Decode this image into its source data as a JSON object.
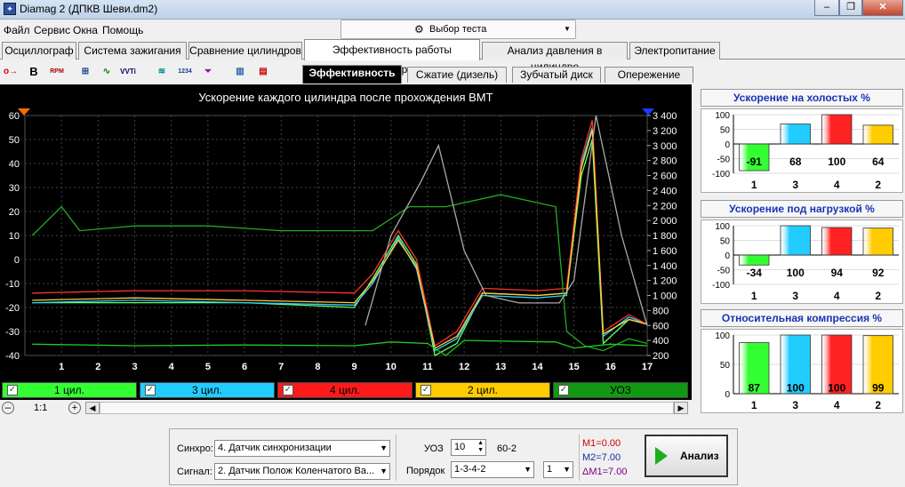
{
  "window": {
    "title": "Diamag 2 (ДПКВ Шеви.dm2)",
    "icon": "app-icon"
  },
  "menu": [
    "Файл",
    "Сервис",
    "Окна",
    "Помощь"
  ],
  "test_select": {
    "label": "Выбор теста",
    "icon": "gear-icon"
  },
  "tabs": [
    "Осциллограф",
    "Система зажигания",
    "Сравнение цилиндров",
    "Эффективность работы цилиндров",
    "Анализ давления в цилиндре",
    "Электропитание"
  ],
  "active_tab": 3,
  "toolbar": {
    "b_label": "B",
    "rpm_label": "RPM",
    "vvt_label": "VVTi",
    "n1234_label": "1234"
  },
  "subtabs": [
    "Эффективность",
    "Сжатие (дизель)",
    "Зубчатый диск",
    "Опережение"
  ],
  "chart_data": {
    "type": "line",
    "title": "Ускорение каждого цилиндра после прохождения ВМТ",
    "x_ticks": [
      "1",
      "2",
      "3",
      "4",
      "5",
      "6",
      "7",
      "8",
      "9",
      "10",
      "11",
      "12",
      "13",
      "14",
      "15",
      "16",
      "17"
    ],
    "xlim": [
      0,
      17
    ],
    "y_left_ticks": [
      "60",
      "50",
      "40",
      "30",
      "20",
      "10",
      "0",
      "-10",
      "-20",
      "-30",
      "-40"
    ],
    "ylim_left": [
      -40,
      60
    ],
    "y_right_ticks": [
      "3 400",
      "3 200",
      "3 000",
      "2 800",
      "2 600",
      "2 400",
      "2 200",
      "2 000",
      "1 800",
      "1 600",
      "1 400",
      "1 200",
      "1 000",
      "800",
      "600",
      "400",
      "200"
    ],
    "ylim_right": [
      200,
      3400
    ],
    "series": [
      {
        "name": "1 цил.",
        "color": "#66ff66",
        "x": [
          0.2,
          3,
          6,
          9,
          9.5,
          10.2,
          10.7,
          11.2,
          11.8,
          12.5,
          14,
          14.8,
          15.2,
          15.5,
          15.8,
          16.5,
          17
        ],
        "values": [
          -18,
          -18,
          -18,
          -20,
          -8,
          10,
          -2,
          -40,
          -35,
          -14,
          -15,
          -14,
          35,
          50,
          -35,
          -25,
          -27
        ]
      },
      {
        "name": "3 цил.",
        "color": "#33ccff",
        "x": [
          0.2,
          3,
          6,
          9,
          9.5,
          10.2,
          10.7,
          11.2,
          11.8,
          12.5,
          14,
          14.8,
          15.2,
          15.5,
          15.8,
          16.5,
          17
        ],
        "values": [
          -18,
          -17,
          -18,
          -19,
          -10,
          9,
          -4,
          -38,
          -33,
          -15,
          -16,
          -15,
          40,
          55,
          -32,
          -24,
          -27
        ]
      },
      {
        "name": "4 цил.",
        "color": "#ff3333",
        "x": [
          0.2,
          3,
          6,
          9,
          9.5,
          10.2,
          10.7,
          11.2,
          11.8,
          12.5,
          14,
          14.8,
          15.2,
          15.5,
          15.8,
          16.5,
          17
        ],
        "values": [
          -14,
          -13,
          -13,
          -14,
          -6,
          12,
          0,
          -36,
          -30,
          -12,
          -13,
          -12,
          42,
          58,
          -30,
          -23,
          -27
        ]
      },
      {
        "name": "2 цил.",
        "color": "#ffcc33",
        "x": [
          0.2,
          3,
          6,
          9,
          9.5,
          10.2,
          10.7,
          11.2,
          11.8,
          12.5,
          14,
          14.8,
          15.2,
          15.5,
          15.8,
          16.5,
          17
        ],
        "values": [
          -17,
          -16,
          -17,
          -18,
          -9,
          8,
          -3,
          -37,
          -32,
          -14,
          -15,
          -14,
          38,
          54,
          -31,
          -25,
          -27
        ]
      },
      {
        "name": "УОЗ",
        "color": "#22aa22",
        "x": [
          0.2,
          1,
          1.5,
          3,
          5,
          7,
          9,
          9.5,
          10.5,
          11.5,
          13,
          14.5,
          14.8,
          15.3,
          15.8,
          16.5,
          17
        ],
        "values": [
          10,
          22,
          12,
          14,
          14,
          12,
          12,
          12,
          22,
          22,
          27,
          22,
          -30,
          -36,
          -38,
          -33,
          -35
        ]
      },
      {
        "name": "RPM",
        "color": "#aaaaaa",
        "axis": "right",
        "x": [
          9.3,
          10,
          10.8,
          11.3,
          12,
          12.6,
          13.5,
          14.6,
          15.0,
          15.6,
          16.3,
          17
        ],
        "values": [
          600,
          1800,
          2500,
          3000,
          1600,
          1000,
          900,
          900,
          1200,
          3400,
          1800,
          600
        ]
      },
      {
        "name": "",
        "color": "#22cc22",
        "axis": "right",
        "x": [
          0.2,
          3,
          6,
          9,
          10,
          11,
          11.5,
          12,
          14.5,
          15,
          16,
          17
        ],
        "values": [
          350,
          330,
          340,
          330,
          380,
          360,
          200,
          400,
          380,
          300,
          350,
          330
        ]
      }
    ]
  },
  "series_bar": [
    {
      "label": "1 цил.",
      "bg": "#33ff33"
    },
    {
      "label": "3 цил.",
      "bg": "#22ccff"
    },
    {
      "label": "4 цил.",
      "bg": "#ff1a1a"
    },
    {
      "label": "2 цил.",
      "bg": "#ffcc00"
    },
    {
      "label": "УОЗ",
      "bg": "#119911"
    }
  ],
  "scroll": {
    "zoom": "1:1"
  },
  "panels": [
    {
      "title": "Ускорение на холостых %",
      "cats": [
        "1",
        "3",
        "4",
        "2"
      ],
      "values": [
        -91,
        68,
        100,
        64
      ],
      "ylim": [
        -100,
        100
      ],
      "ticks": [
        "100",
        "50",
        "0",
        "-50",
        "-100"
      ]
    },
    {
      "title": "Ускорение под нагрузкой %",
      "cats": [
        "1",
        "3",
        "4",
        "2"
      ],
      "values": [
        -34,
        100,
        94,
        92
      ],
      "ylim": [
        -100,
        100
      ],
      "ticks": [
        "100",
        "50",
        "0",
        "-50",
        "-100"
      ]
    },
    {
      "title": "Относительная компрессия %",
      "cats": [
        "1",
        "3",
        "4",
        "2"
      ],
      "values": [
        87,
        100,
        100,
        99
      ],
      "ylim": [
        0,
        100
      ],
      "ticks": [
        "100",
        "50",
        "0"
      ]
    }
  ],
  "bar_colors": [
    "#33ff33",
    "#22ccff",
    "#ff2222",
    "#ffcc00"
  ],
  "bottom": {
    "sync_label": "Синхро:",
    "sync_value": "4. Датчик синхронизации",
    "signal_label": "Сигнал:",
    "signal_value": "2. Датчик Полож Коленчатого Ва...",
    "uoz_label": "УОЗ",
    "uoz_value": "10",
    "uoz_extra": "60-2",
    "order_label": "Порядок",
    "order_value": "1-3-4-2",
    "order_num": "1",
    "m1": "M1=0.00",
    "m2": "M2=7.00",
    "dm": "ΔM1=7.00",
    "analysis": "Анализ"
  }
}
